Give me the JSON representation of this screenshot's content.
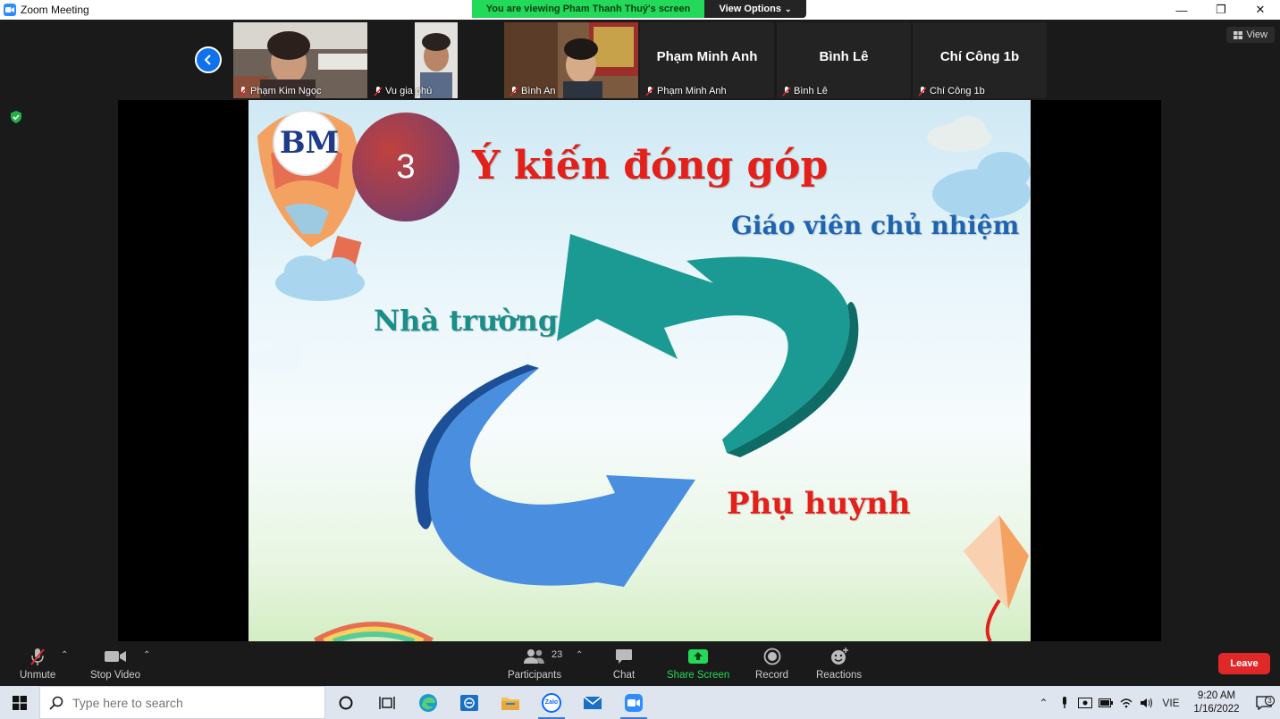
{
  "window": {
    "title": "Zoom Meeting"
  },
  "banner": {
    "viewing_text": "You are viewing Pham  Thanh  Thuý's screen",
    "view_options": "View Options"
  },
  "gallery": {
    "view_label": "View",
    "participants": [
      {
        "name": "Phạm Kim Ngọc",
        "muted": true,
        "has_video": true
      },
      {
        "name": "Vu gia phú",
        "muted": true,
        "has_video": true
      },
      {
        "name": "Bình An",
        "muted": true,
        "has_video": true
      },
      {
        "name": "Phạm Minh Anh",
        "display_name": "Phạm Minh Anh",
        "muted": true,
        "has_video": false
      },
      {
        "name": "Bình Lê",
        "display_name": "Bình Lê",
        "muted": true,
        "has_video": false
      },
      {
        "name": "Chí Công 1b",
        "display_name": "Chí Công 1b",
        "muted": true,
        "has_video": false
      }
    ]
  },
  "slide": {
    "logo_text": "BM",
    "number": "3",
    "title": "Ý kiến đóng góp",
    "labels": {
      "homeroom_teacher": "Giáo viên chủ nhiệm",
      "school": "Nhà trường",
      "parents": "Phụ huynh"
    }
  },
  "toolbar": {
    "unmute": "Unmute",
    "stop_video": "Stop Video",
    "participants": "Participants",
    "participants_count": "23",
    "chat": "Chat",
    "share_screen": "Share Screen",
    "record": "Record",
    "reactions": "Reactions",
    "leave": "Leave"
  },
  "taskbar": {
    "search_placeholder": "Type here to search",
    "language": "VIE",
    "time": "9:20 AM",
    "date": "1/16/2022",
    "notifications": "3",
    "zalo_label": "Zalo"
  },
  "colors": {
    "share_green": "#23d959",
    "zoom_blue": "#0e72ed",
    "leave_red": "#e02828",
    "title_red": "#e3201a",
    "teal": "#1b8e8a",
    "blue": "#1e64b0"
  }
}
